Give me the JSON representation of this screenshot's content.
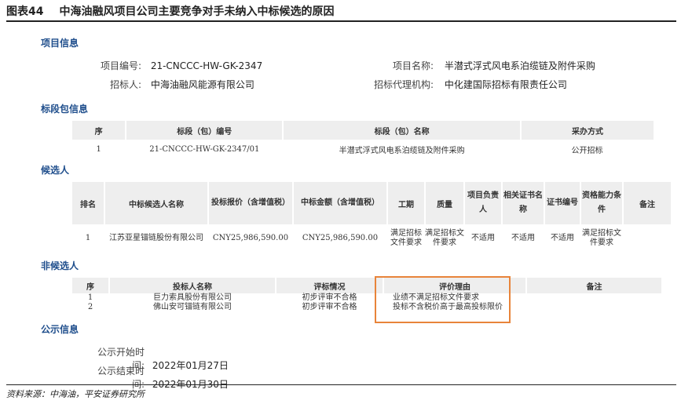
{
  "figure": {
    "label": "图表44",
    "title": "中海油融风项目公司主要竞争对手未纳入中标候选的原因"
  },
  "project_info": {
    "heading": "项目信息",
    "number_label": "项目编号:",
    "number_value": "21-CNCCC-HW-GK-2347",
    "name_label": "项目名称:",
    "name_value": "半潜式浮式风电系泊缆链及附件采购",
    "tenderer_label": "招标人:",
    "tenderer_value": "中海油融风能源有限公司",
    "agency_label": "招标代理机构:",
    "agency_value": "中化建国际招标有限责任公司"
  },
  "lot_info": {
    "heading": "标段包信息",
    "headers": [
      "序",
      "标段（包）编号",
      "标段（包）名称",
      "采办方式"
    ],
    "rows": [
      [
        "1",
        "21-CNCCC-HW-GK-2347/01",
        "半潜式浮式风电系泊缆链及附件采购",
        "公开招标"
      ]
    ]
  },
  "candidates": {
    "heading": "候选人",
    "headers": [
      "排名",
      "中标候选人名称",
      "投标报价（含增值税）",
      "中标金额（含增值税）",
      "工期",
      "质量",
      "项目负责人",
      "相关证书名称",
      "证书编号",
      "资格能力条件",
      "备注"
    ],
    "rows": [
      [
        "1",
        "江苏亚星锚链股份有限公司",
        "CNY25,986,590.00",
        "CNY25,986,590.00",
        "满足招标文件要求",
        "满足招标文件要求",
        "不适用",
        "不适用",
        "不适用",
        "满足招标文件要求",
        ""
      ]
    ]
  },
  "non_candidates": {
    "heading": "非候选人",
    "headers": [
      "序",
      "投标人名称",
      "评标情况",
      "评价理由",
      "备注"
    ],
    "rows": [
      [
        "1",
        "巨力索具股份有限公司",
        "初步评审不合格",
        "业绩不满足招标文件要求",
        ""
      ],
      [
        "2",
        "佛山安可锚链有限公司",
        "初步评审不合格",
        "投标不含税价高于最高投标限价",
        ""
      ]
    ],
    "highlight_color": "#e8843a"
  },
  "publicity": {
    "heading": "公示信息",
    "start_label": "公示开始时间:",
    "start_value": "2022年01月27日",
    "end_label": "公示结束时间:",
    "end_value": "2022年01月30日"
  },
  "source": "资料来源：中海油，平安证券研究所"
}
